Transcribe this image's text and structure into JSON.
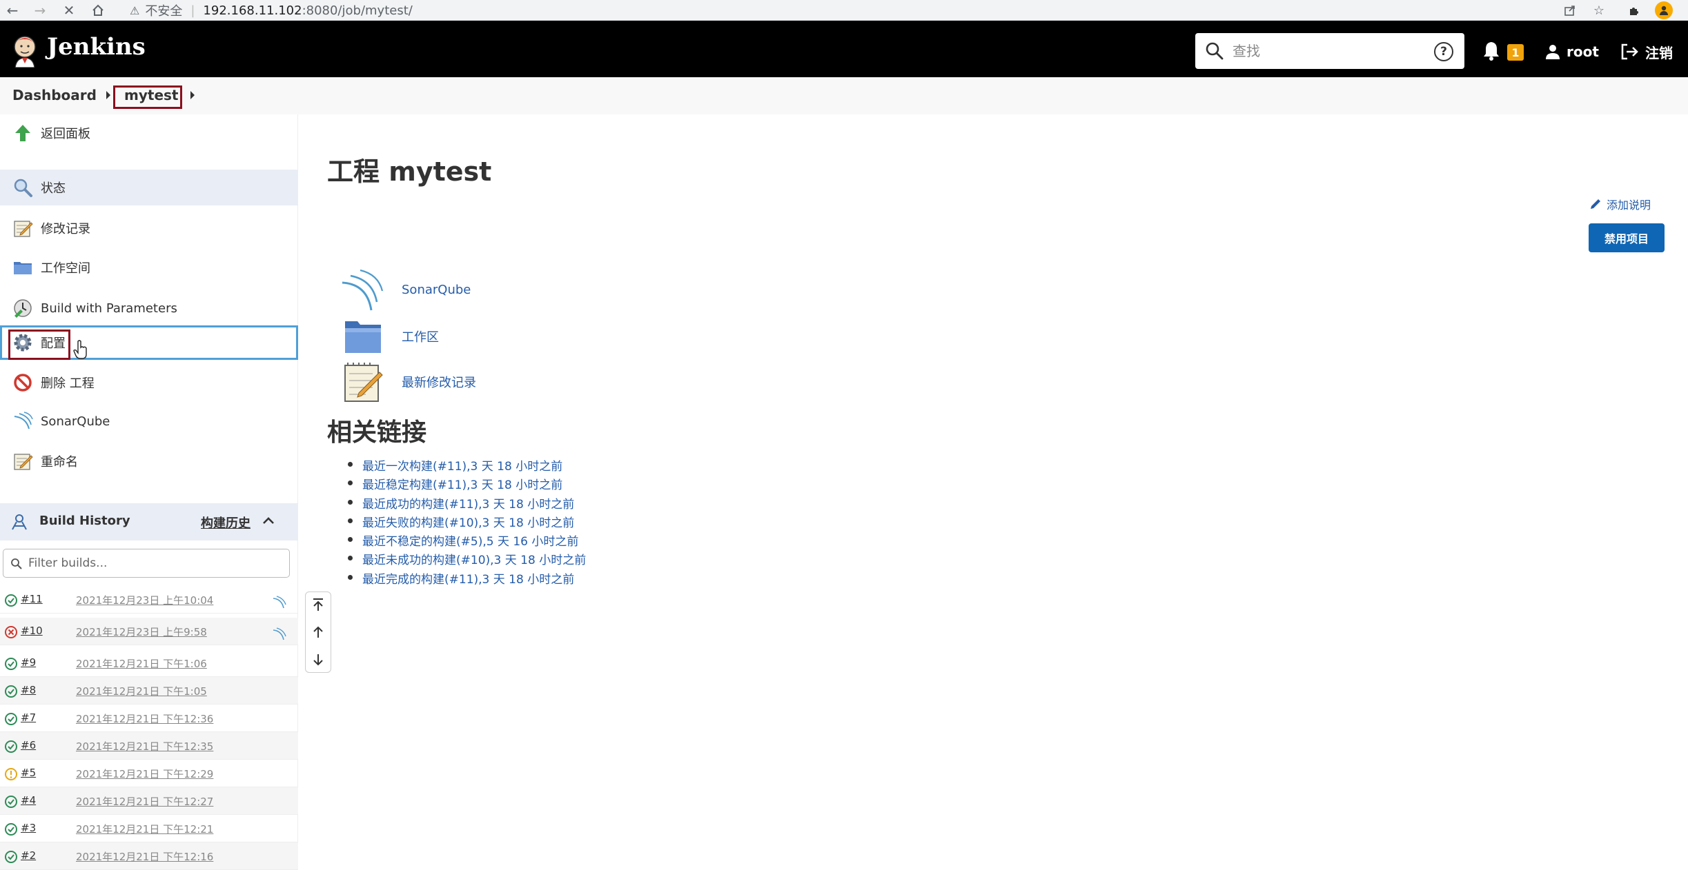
{
  "browser": {
    "security_label": "不安全",
    "url_host": "192.168.11.102",
    "url_path": ":8080/job/mytest/"
  },
  "header": {
    "brand": "Jenkins",
    "search_placeholder": "查找",
    "notification_count": "1",
    "user": "root",
    "logout": "注销"
  },
  "breadcrumb": {
    "items": [
      "Dashboard",
      "mytest"
    ]
  },
  "sidebar": {
    "items": [
      {
        "label": "返回面板",
        "icon": "up-arrow-icon"
      },
      {
        "label": "状态",
        "icon": "search-icon"
      },
      {
        "label": "修改记录",
        "icon": "notepad-icon"
      },
      {
        "label": "工作空间",
        "icon": "folder-icon"
      },
      {
        "label": "Build with Parameters",
        "icon": "build-clock-icon"
      },
      {
        "label": "配置",
        "icon": "gear-icon"
      },
      {
        "label": "删除 工程",
        "icon": "no-entry-icon"
      },
      {
        "label": "SonarQube",
        "icon": "sonarqube-icon"
      },
      {
        "label": "重命名",
        "icon": "notepad-icon"
      }
    ]
  },
  "build_history": {
    "title": "Build History",
    "link_label": "构建历史",
    "filter_placeholder": "Filter builds...",
    "builds": [
      {
        "number": "#11",
        "date": "2021年12月23日 上午10:04",
        "status": "success",
        "sonar": true
      },
      {
        "number": "#10",
        "date": "2021年12月23日 上午9:58",
        "status": "failed",
        "sonar": true
      },
      {
        "number": "#9",
        "date": "2021年12月21日 下午1:06",
        "status": "success",
        "sonar": false
      },
      {
        "number": "#8",
        "date": "2021年12月21日 下午1:05",
        "status": "success",
        "sonar": false
      },
      {
        "number": "#7",
        "date": "2021年12月21日 下午12:36",
        "status": "success",
        "sonar": false
      },
      {
        "number": "#6",
        "date": "2021年12月21日 下午12:35",
        "status": "success",
        "sonar": false
      },
      {
        "number": "#5",
        "date": "2021年12月21日 下午12:29",
        "status": "unstable",
        "sonar": false
      },
      {
        "number": "#4",
        "date": "2021年12月21日 下午12:27",
        "status": "success",
        "sonar": false
      },
      {
        "number": "#3",
        "date": "2021年12月21日 下午12:21",
        "status": "success",
        "sonar": false
      },
      {
        "number": "#2",
        "date": "2021年12月21日 下午12:16",
        "status": "success",
        "sonar": false
      }
    ]
  },
  "main": {
    "title": "工程 mytest",
    "add_description": "添加说明",
    "disable_button": "禁用项目",
    "actions": [
      {
        "label": "SonarQube",
        "icon": "sonarqube-icon"
      },
      {
        "label": "工作区",
        "icon": "folder-icon"
      },
      {
        "label": "最新修改记录",
        "icon": "notepad-icon"
      }
    ],
    "related_title": "相关链接",
    "permalinks": [
      "最近一次构建(#11),3 天 18 小时之前",
      "最近稳定构建(#11),3 天 18 小时之前",
      "最近成功的构建(#11),3 天 18 小时之前",
      "最近失败的构建(#10),3 天 18 小时之前",
      "最近不稳定的构建(#5),5 天 16 小时之前",
      "最近未成功的构建(#10),3 天 18 小时之前",
      "最近完成的构建(#11),3 天 18 小时之前"
    ]
  },
  "colors": {
    "header_bg": "#000000",
    "link_blue": "#245caa",
    "primary_button": "#0f66b4",
    "highlight_box": "#8b0f1e",
    "hover_border": "#4ea0d8",
    "badge": "#f0a30a"
  }
}
